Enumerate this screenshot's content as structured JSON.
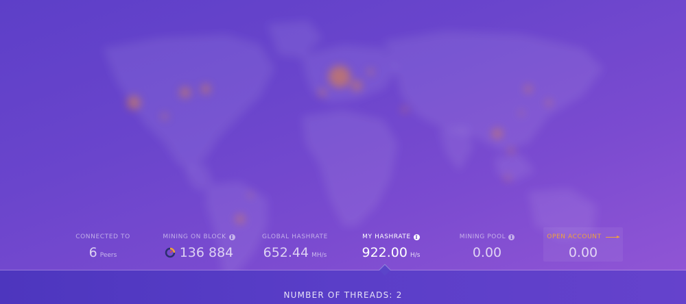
{
  "stats": {
    "connected": {
      "label": "CONNECTED TO",
      "value": "6",
      "unit": "Peers"
    },
    "block": {
      "label": "MINING ON BLOCK",
      "value": "136 884"
    },
    "global_hashrate": {
      "label": "GLOBAL HASHRATE",
      "value": "652.44",
      "unit": "MH/s"
    },
    "my_hashrate": {
      "label": "MY HASHRATE",
      "value": "922.00",
      "unit": "H/s"
    },
    "mining_pool": {
      "label": "MINING POOL",
      "value": "0.00"
    },
    "open_account": {
      "label": "OPEN ACCOUNT",
      "value": "0.00"
    }
  },
  "threads": {
    "label": "NUMBER OF THREADS: 2"
  },
  "colors": {
    "accent_orange": "#f0a33a",
    "bg_start": "#5d3fc8",
    "bg_end": "#9457d6"
  },
  "icons": [
    "info-icon",
    "gauge-icon",
    "arrow-right-icon"
  ]
}
